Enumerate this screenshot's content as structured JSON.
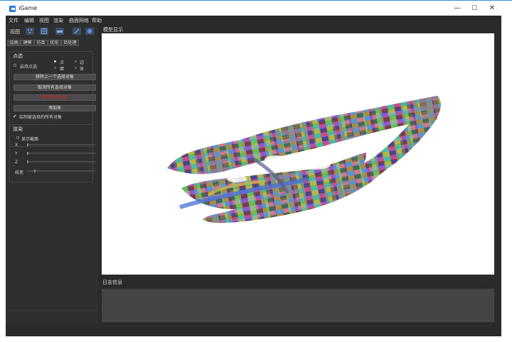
{
  "window": {
    "title": "iGame",
    "controls": {
      "minimize": "—",
      "maximize": "☐",
      "close": "✕"
    }
  },
  "menu": [
    "文件",
    "编辑",
    "视图",
    "渲染",
    "曲面网格",
    "帮助"
  ],
  "toolbar": {
    "label": "视图",
    "icons": [
      "points-icon",
      "grid-icon",
      "flat-icon",
      "edit-icon",
      "sphere-icon"
    ]
  },
  "tabs": [
    "公共",
    "建模",
    "仿真",
    "优化",
    "后处理"
  ],
  "selection": {
    "title": "点选",
    "enable_label": "启用点选",
    "radios": [
      "点",
      "边",
      "面",
      "体"
    ],
    "buttons": [
      "移除上一个选择对象",
      "取消所有选择对象",
      "删除所选对象",
      "添加体"
    ],
    "draw_all_label": "绘制被选择的所有对象"
  },
  "render": {
    "title": "渲染",
    "show_section_label": "显示截面",
    "axes": [
      "X",
      "Y",
      "Z"
    ],
    "linewidth_label": "线宽"
  },
  "viewport": {
    "title": "模型显示"
  },
  "log": {
    "title": "日志信息",
    "dots": "· ·"
  },
  "colors": {
    "accent": "#2a7fd4",
    "delete_text": "#cc2222",
    "panel": "#2f2f2f"
  }
}
